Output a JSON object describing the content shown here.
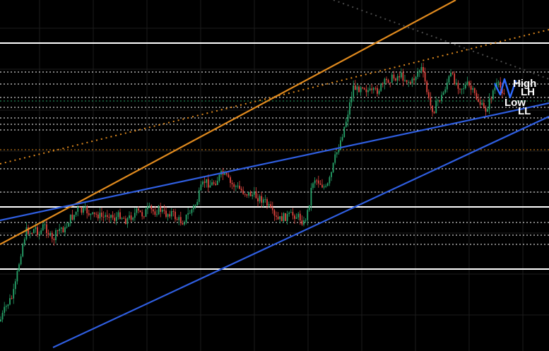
{
  "chart_data": {
    "type": "candlestick",
    "title": "",
    "xlabel": "",
    "ylabel": "",
    "grid": true,
    "theme": {
      "background": "#000000",
      "grid": "#1c1c1c",
      "up": "#26a269",
      "down": "#e0443e"
    },
    "ylim": [
      0,
      497
    ],
    "series": [
      {
        "close_path": [
          [
            0,
            455
          ],
          [
            6,
            440
          ],
          [
            12,
            428
          ],
          [
            18,
            420
          ],
          [
            22,
            402
          ],
          [
            26,
            378
          ],
          [
            30,
            355
          ],
          [
            34,
            338
          ],
          [
            38,
            325
          ],
          [
            44,
            330
          ],
          [
            50,
            322
          ],
          [
            56,
            332
          ],
          [
            62,
            318
          ],
          [
            68,
            328
          ],
          [
            74,
            342
          ],
          [
            80,
            330
          ],
          [
            86,
            322
          ],
          [
            92,
            326
          ],
          [
            98,
            310
          ],
          [
            104,
            306
          ],
          [
            110,
            296
          ],
          [
            116,
            300
          ],
          [
            122,
            298
          ],
          [
            130,
            306
          ],
          [
            138,
            304
          ],
          [
            146,
            308
          ],
          [
            154,
            302
          ],
          [
            162,
            310
          ],
          [
            170,
            304
          ],
          [
            178,
            312
          ],
          [
            186,
            306
          ],
          [
            194,
            300
          ],
          [
            202,
            304
          ],
          [
            210,
            296
          ],
          [
            218,
            300
          ],
          [
            226,
            296
          ],
          [
            234,
            304
          ],
          [
            242,
            300
          ],
          [
            250,
            310
          ],
          [
            258,
            314
          ],
          [
            266,
            304
          ],
          [
            272,
            296
          ],
          [
            278,
            288
          ],
          [
            284,
            268
          ],
          [
            290,
            256
          ],
          [
            298,
            262
          ],
          [
            306,
            256
          ],
          [
            314,
            246
          ],
          [
            320,
            250
          ],
          [
            326,
            260
          ],
          [
            334,
            264
          ],
          [
            342,
            270
          ],
          [
            350,
            274
          ],
          [
            358,
            276
          ],
          [
            366,
            280
          ],
          [
            374,
            284
          ],
          [
            382,
            296
          ],
          [
            388,
            308
          ],
          [
            394,
            312
          ],
          [
            400,
            308
          ],
          [
            408,
            306
          ],
          [
            416,
            304
          ],
          [
            424,
            308
          ],
          [
            430,
            316
          ],
          [
            436,
            298
          ],
          [
            440,
            270
          ],
          [
            444,
            252
          ],
          [
            450,
            256
          ],
          [
            456,
            262
          ],
          [
            462,
            268
          ],
          [
            468,
            250
          ],
          [
            474,
            224
          ],
          [
            480,
            206
          ],
          [
            486,
            184
          ],
          [
            490,
            170
          ],
          [
            496,
            142
          ],
          [
            500,
            122
          ],
          [
            506,
            128
          ],
          [
            512,
            118
          ],
          [
            518,
            126
          ],
          [
            526,
            132
          ],
          [
            534,
            128
          ],
          [
            542,
            120
          ],
          [
            550,
            112
          ],
          [
            558,
            110
          ],
          [
            566,
            106
          ],
          [
            574,
            112
          ],
          [
            582,
            118
          ],
          [
            590,
            104
          ],
          [
            596,
            96
          ],
          [
            602,
            118
          ],
          [
            608,
            148
          ],
          [
            614,
            156
          ],
          [
            620,
            142
          ],
          [
            626,
            136
          ],
          [
            632,
            118
          ],
          [
            638,
            106
          ],
          [
            646,
            118
          ],
          [
            654,
            124
          ],
          [
            662,
            120
          ],
          [
            670,
            132
          ],
          [
            678,
            144
          ],
          [
            686,
            158
          ],
          [
            692,
            146
          ],
          [
            698,
            128
          ],
          [
            704,
            120
          ],
          [
            710,
            126
          ],
          [
            716,
            132
          ]
        ]
      }
    ],
    "horizontal_levels": [
      {
        "style": "solid",
        "color": "#ffffff",
        "price_y": 61
      },
      {
        "style": "solid",
        "color": "#ffffff",
        "price_y": 293
      },
      {
        "style": "solid",
        "color": "#ffffff",
        "price_y": 381
      },
      {
        "style": "dotted",
        "color": "#ffffff",
        "price_y": 102
      },
      {
        "style": "dotted",
        "color": "#ffffff",
        "price_y": 119
      },
      {
        "style": "dotted",
        "color": "#ffffff",
        "price_y": 138
      },
      {
        "style": "dotted",
        "color": "#ffffff",
        "price_y": 152
      },
      {
        "style": "dotted",
        "color": "#ffffff",
        "price_y": 167
      },
      {
        "style": "dotted",
        "color": "#ffffff",
        "price_y": 176
      },
      {
        "style": "dotted",
        "color": "#ffffff",
        "price_y": 184
      },
      {
        "style": "dotted",
        "color": "#ffffff",
        "price_y": 239
      },
      {
        "style": "dotted",
        "color": "#ffffff",
        "price_y": 272
      },
      {
        "style": "dotted",
        "color": "#ffffff",
        "price_y": 315
      },
      {
        "style": "dotted",
        "color": "#ffffff",
        "price_y": 333
      },
      {
        "style": "dotted",
        "color": "#ffffff",
        "price_y": 346
      },
      {
        "style": "dotted",
        "color": "#e08a1e",
        "price_y": 212
      },
      {
        "style": "dotted",
        "color": "#26a269",
        "price_y": 143
      }
    ],
    "trendlines": [
      {
        "color": "#e08a1e",
        "style": "solid",
        "from": [
          0,
          346
        ],
        "to": [
          645,
          0
        ]
      },
      {
        "color": "#e08a1e",
        "style": "dotted",
        "from": [
          0,
          232
        ],
        "to": [
          777,
          42
        ]
      },
      {
        "color": "#2f5ee0",
        "style": "solid",
        "from": [
          0,
          312
        ],
        "to": [
          777,
          146
        ]
      },
      {
        "color": "#2f5ee0",
        "style": "solid",
        "from": [
          75,
          492
        ],
        "to": [
          777,
          165
        ]
      },
      {
        "color": "#4a4a4a",
        "style": "dotted",
        "from": [
          472,
          0
        ],
        "to": [
          777,
          112
        ]
      }
    ],
    "annotations": [
      {
        "text": "High",
        "price_y": 118
      },
      {
        "text": "LH",
        "price_y": 130
      },
      {
        "text": "Low",
        "price_y": 145
      },
      {
        "text": "LL",
        "price_y": 157
      }
    ],
    "swing_zigzag": [
      [
        700,
        118
      ],
      [
        708,
        134
      ],
      [
        714,
        112
      ],
      [
        722,
        138
      ],
      [
        730,
        114
      ]
    ]
  }
}
